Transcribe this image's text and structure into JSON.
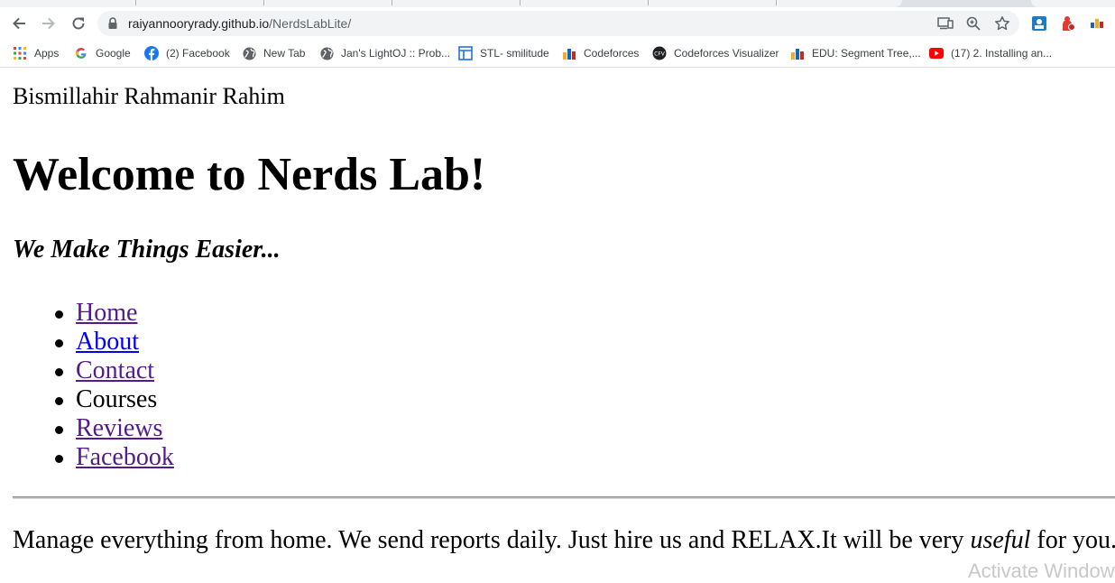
{
  "browser": {
    "url_host": "raiyannooryrady.github.io",
    "url_path": "/NerdsLabLite/",
    "nav": {
      "back_icon": "arrow-left-icon",
      "forward_icon": "arrow-right-icon",
      "reload_icon": "reload-icon"
    },
    "bookmarks": [
      {
        "label": "Apps",
        "icon": "apps-grid-icon"
      },
      {
        "label": "Google",
        "icon": "google-icon"
      },
      {
        "label": "(2) Facebook",
        "icon": "facebook-icon"
      },
      {
        "label": "New Tab",
        "icon": "globe-icon"
      },
      {
        "label": "Jan's LightOJ :: Prob...",
        "icon": "globe-icon"
      },
      {
        "label": "STL- smilitude",
        "icon": "layout-icon"
      },
      {
        "label": "Codeforces",
        "icon": "codeforces-icon"
      },
      {
        "label": "Codeforces Visualizer",
        "icon": "cfv-icon"
      },
      {
        "label": "EDU: Segment Tree,...",
        "icon": "codeforces-icon"
      },
      {
        "label": "(17) 2. Installing an...",
        "icon": "youtube-icon"
      }
    ]
  },
  "page": {
    "greeting": "Bismillahir Rahmanir Rahim",
    "title": "Welcome to Nerds Lab!",
    "tagline": "We Make Things Easier...",
    "menu": [
      {
        "label": "Home",
        "link": true
      },
      {
        "label": "About",
        "link": true
      },
      {
        "label": "Contact",
        "link": true
      },
      {
        "label": "Courses",
        "link": false
      },
      {
        "label": "Reviews",
        "link": true
      },
      {
        "label": "Facebook",
        "link": true
      }
    ],
    "body_text_before": "Manage everything from home. We send reports daily. Just hire us and RELAX.It will be very ",
    "body_text_emphasis": "useful",
    "body_text_after": " for you."
  },
  "os": {
    "watermark": "Activate Windows"
  },
  "colors": {
    "visited_link": "#551a8b",
    "unvisited_link": "#0000ee"
  }
}
